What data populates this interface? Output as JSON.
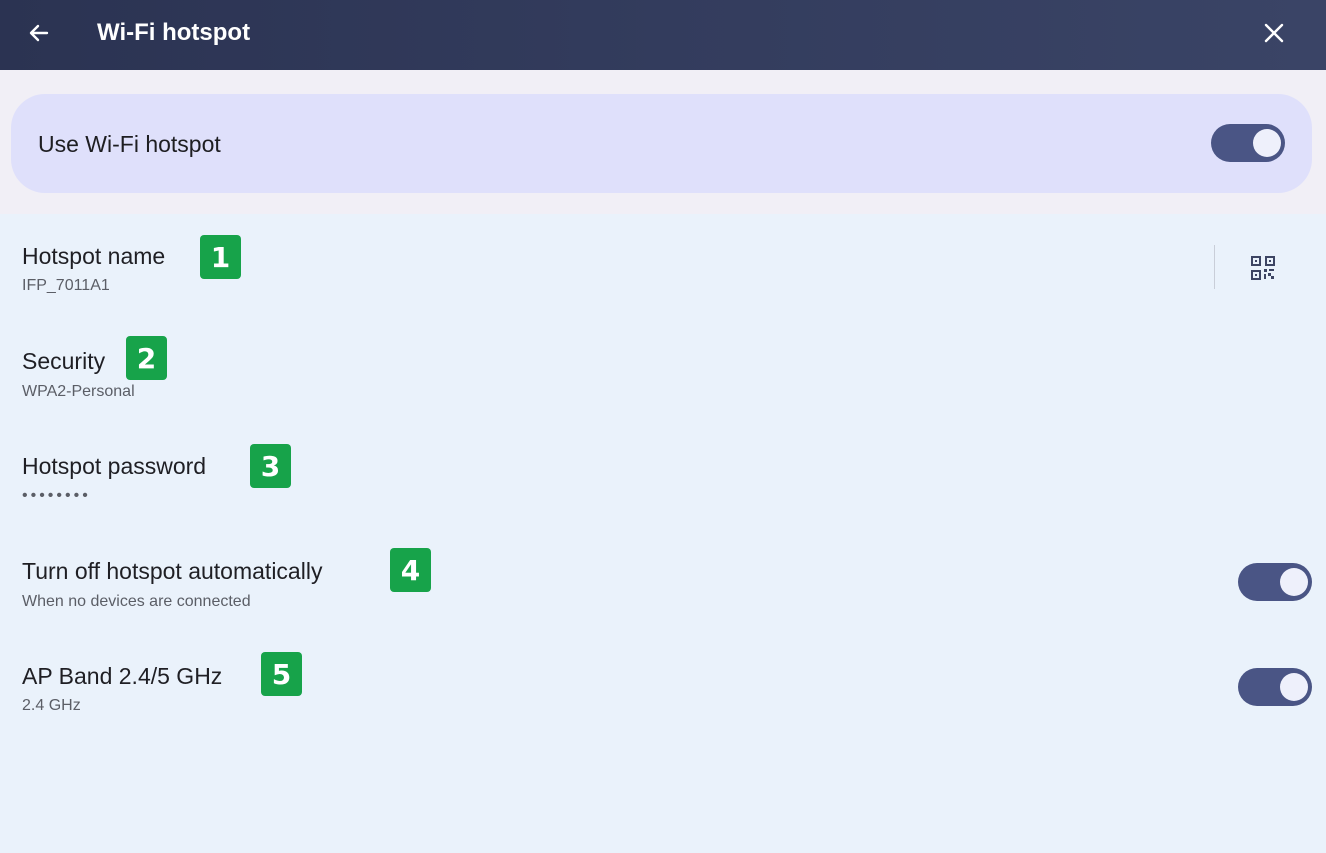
{
  "header": {
    "title": "Wi-Fi hotspot",
    "back_icon": "arrow-left-icon",
    "close_icon": "close-icon"
  },
  "master": {
    "label": "Use Wi-Fi hotspot",
    "enabled": true
  },
  "items": [
    {
      "title": "Hotspot name",
      "subtitle": "IFP_7011A1",
      "badge": "1",
      "action_icon": "qr-code-icon"
    },
    {
      "title": "Security",
      "subtitle": "WPA2-Personal",
      "badge": "2"
    },
    {
      "title": "Hotspot password",
      "subtitle": "••••••••",
      "badge": "3"
    },
    {
      "title": "Turn off hotspot automatically",
      "subtitle": "When no devices are connected",
      "badge": "4",
      "enabled": true
    },
    {
      "title": "AP Band 2.4/5 GHz",
      "subtitle": "2.4 GHz",
      "badge": "5",
      "enabled": true
    }
  ],
  "colors": {
    "header_bg": "#333c5d",
    "card_bg": "#dfe0fb",
    "page_bg": "#eaf2fb",
    "switch_on": "#4a5585",
    "badge": "#17a34a"
  }
}
